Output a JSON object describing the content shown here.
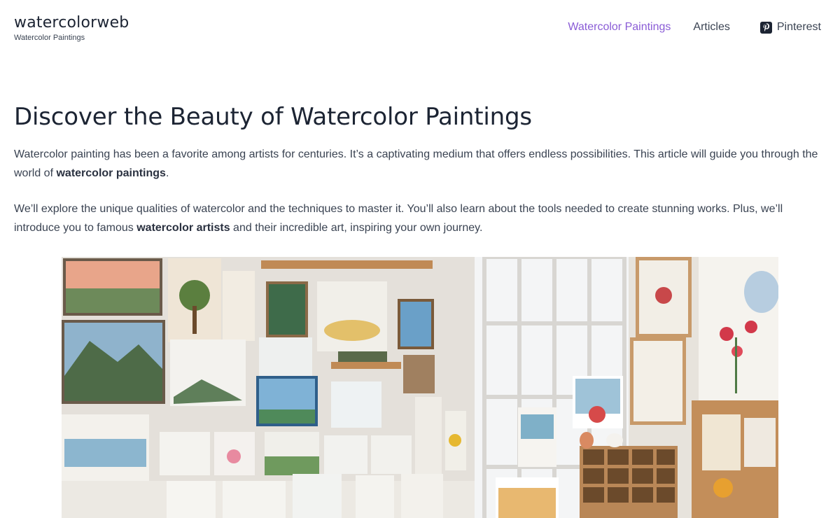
{
  "site": {
    "title": "watercolorweb",
    "tagline": "Watercolor Paintings"
  },
  "nav": {
    "items": [
      {
        "label": "Watercolor Paintings"
      },
      {
        "label": "Articles"
      },
      {
        "label": "Pinterest",
        "icon": "pinterest-icon"
      }
    ],
    "active_color": "#8a5cd6"
  },
  "article": {
    "heading": "Discover the Beauty of Watercolor Paintings",
    "p1": {
      "pre": "Watercolor painting has been a favorite among artists for centuries. It’s a captivating medium that offers endless possibilities. This article will guide you through the world of ",
      "bold": "watercolor paintings",
      "post": "."
    },
    "p2": {
      "pre": "We’ll explore the unique qualities of watercolor and the techniques to master it. You’ll also learn about the tools needed to create stunning works. Plus, we’ll introduce you to famous ",
      "bold": "watercolor artists",
      "post": " and their incredible art, inspiring your own journey."
    }
  },
  "colors": {
    "heading": "#1c2433",
    "body_text": "#3a4352",
    "accent": "#8a5cd6"
  }
}
